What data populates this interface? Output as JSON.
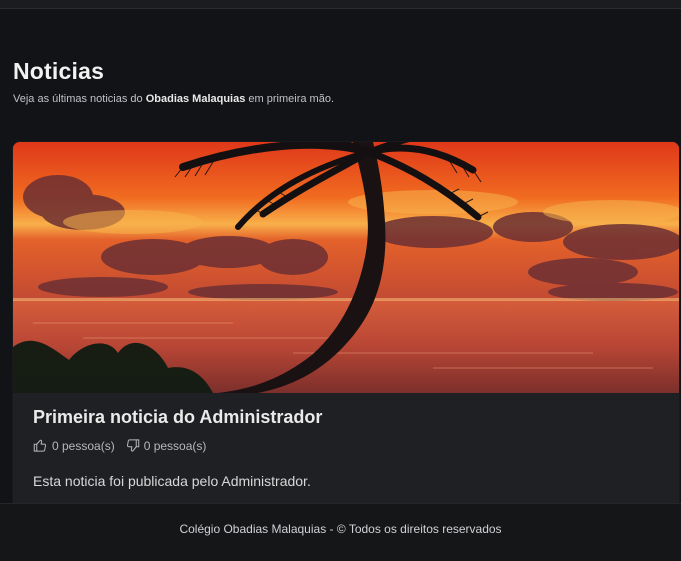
{
  "header": {
    "title": "Noticias",
    "subtitle_prefix": "Veja as últimas noticias do",
    "subtitle_bold": "Obadias Malaquias",
    "subtitle_suffix": "em primeira mão."
  },
  "news": {
    "title": "Primeira noticia do Administrador",
    "likes_text": "0 pessoa(s)",
    "dislikes_text": "0 pessoa(s)",
    "body": "Esta noticia foi publicada pelo Administrador.",
    "image_icon": "palm-tree-sunset-image"
  },
  "footer": {
    "text": "Colégio Obadias Malaquias - © Todos os direitos reservados"
  }
}
